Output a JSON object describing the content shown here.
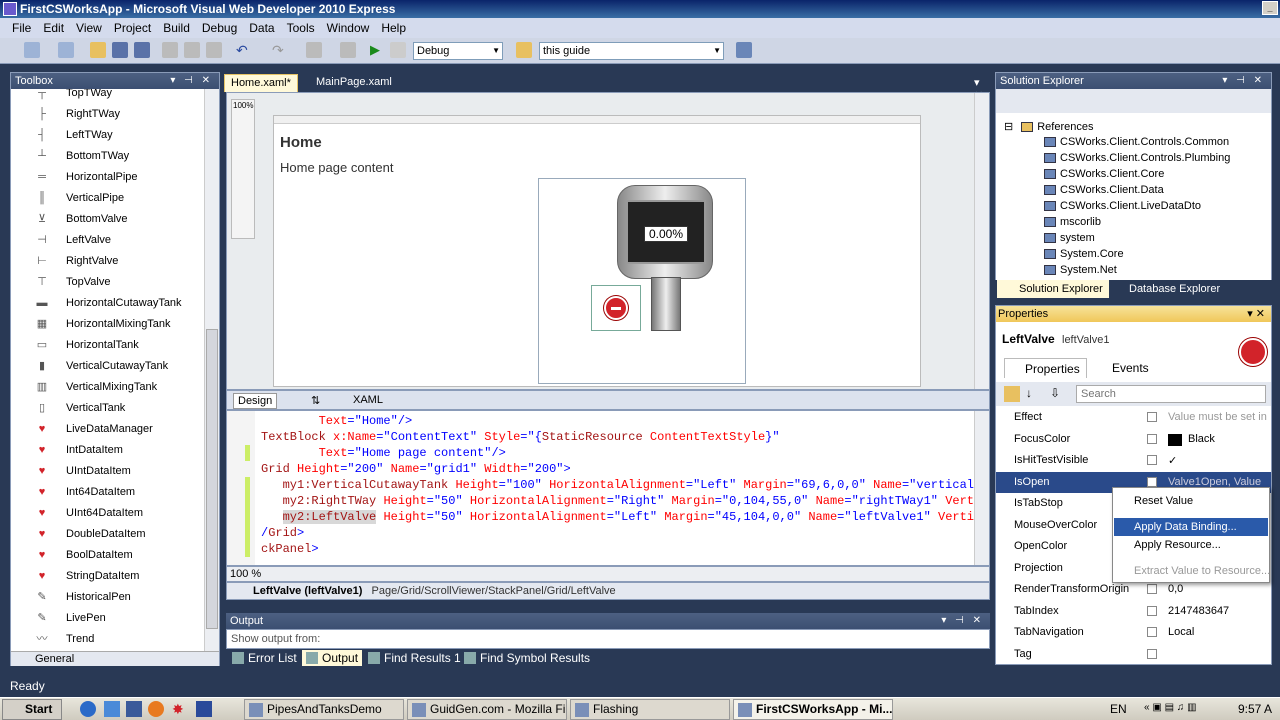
{
  "window": {
    "title": "FirstCSWorksApp - Microsoft Visual Web Developer 2010 Express"
  },
  "menu": [
    "File",
    "Edit",
    "View",
    "Project",
    "Build",
    "Debug",
    "Data",
    "Tools",
    "Window",
    "Help"
  ],
  "toolbar": {
    "config": "Debug",
    "find": "this guide"
  },
  "toolbox": {
    "title": "Toolbox",
    "items": [
      {
        "label": "TopTWay",
        "icon": "┬"
      },
      {
        "label": "RightTWay",
        "icon": "├"
      },
      {
        "label": "LeftTWay",
        "icon": "┤"
      },
      {
        "label": "BottomTWay",
        "icon": "┴"
      },
      {
        "label": "HorizontalPipe",
        "icon": "═"
      },
      {
        "label": "VerticalPipe",
        "icon": "║"
      },
      {
        "label": "BottomValve",
        "icon": "⊻"
      },
      {
        "label": "LeftValve",
        "icon": "⊣"
      },
      {
        "label": "RightValve",
        "icon": "⊢"
      },
      {
        "label": "TopValve",
        "icon": "⊤"
      },
      {
        "label": "HorizontalCutawayTank",
        "icon": "▬"
      },
      {
        "label": "HorizontalMixingTank",
        "icon": "▦"
      },
      {
        "label": "HorizontalTank",
        "icon": "▭"
      },
      {
        "label": "VerticalCutawayTank",
        "icon": "▮"
      },
      {
        "label": "VerticalMixingTank",
        "icon": "▥"
      },
      {
        "label": "VerticalTank",
        "icon": "▯"
      },
      {
        "label": "LiveDataManager",
        "icon": "♥"
      },
      {
        "label": "IntDataItem",
        "icon": "♥"
      },
      {
        "label": "UIntDataItem",
        "icon": "♥"
      },
      {
        "label": "Int64DataItem",
        "icon": "♥"
      },
      {
        "label": "UInt64DataItem",
        "icon": "♥"
      },
      {
        "label": "DoubleDataItem",
        "icon": "♥"
      },
      {
        "label": "BoolDataItem",
        "icon": "♥"
      },
      {
        "label": "StringDataItem",
        "icon": "♥"
      },
      {
        "label": "HistoricalPen",
        "icon": "✎"
      },
      {
        "label": "LivePen",
        "icon": "✎"
      },
      {
        "label": "Trend",
        "icon": "〰"
      }
    ],
    "general": "General"
  },
  "doc_tabs": [
    "Home.xaml*",
    "MainPage.xaml"
  ],
  "designer": {
    "zoom_small": "100%",
    "page_title": "Home",
    "page_content": "Home page content",
    "tank_value": "0.00%"
  },
  "split_tabs": {
    "design": "Design",
    "swap": "⇅",
    "xaml": "XAML"
  },
  "code": [
    {
      "indent": "        ",
      "parts": [
        [
          "at",
          "Text"
        ],
        [
          "pu",
          "=\"Home\"/>"
        ]
      ]
    },
    {
      "indent": "",
      "parts": [
        [
          "kw",
          "TextBlock "
        ],
        [
          "at",
          "x:Name"
        ],
        [
          "pu",
          "=\"ContentText\" "
        ],
        [
          "at",
          "Style"
        ],
        [
          "pu",
          "=\"{"
        ],
        [
          "kw",
          "StaticResource "
        ],
        [
          "at",
          "ContentTextStyle"
        ],
        [
          "pu",
          "}\""
        ]
      ]
    },
    {
      "indent": "        ",
      "parts": [
        [
          "at",
          "Text"
        ],
        [
          "pu",
          "=\"Home page content\"/>"
        ]
      ]
    },
    {
      "indent": "",
      "parts": [
        [
          "kw",
          "Grid "
        ],
        [
          "at",
          "Height"
        ],
        [
          "pu",
          "=\"200\" "
        ],
        [
          "at",
          "Name"
        ],
        [
          "pu",
          "=\"grid1\" "
        ],
        [
          "at",
          "Width"
        ],
        [
          "pu",
          "=\"200\">"
        ]
      ]
    },
    {
      "indent": "   ",
      "parts": [
        [
          "kw",
          "my1:VerticalCutawayTank "
        ],
        [
          "at",
          "Height"
        ],
        [
          "pu",
          "=\"100\" "
        ],
        [
          "at",
          "HorizontalAlignment"
        ],
        [
          "pu",
          "=\"Left\" "
        ],
        [
          "at",
          "Margin"
        ],
        [
          "pu",
          "=\"69,6,0,0\" "
        ],
        [
          "at",
          "Name"
        ],
        [
          "pu",
          "=\"verticalC"
        ]
      ]
    },
    {
      "indent": "   ",
      "parts": [
        [
          "kw",
          "my2:RightTWay "
        ],
        [
          "at",
          "Height"
        ],
        [
          "pu",
          "=\"50\" "
        ],
        [
          "at",
          "HorizontalAlignment"
        ],
        [
          "pu",
          "=\"Right\" "
        ],
        [
          "at",
          "Margin"
        ],
        [
          "pu",
          "=\"0,104,55,0\" "
        ],
        [
          "at",
          "Name"
        ],
        [
          "pu",
          "=\"rightTWay1\" "
        ],
        [
          "at",
          "Verti"
        ]
      ]
    },
    {
      "indent": "   ",
      "parts": [
        [
          "hl",
          "my2:LeftValve"
        ],
        [
          "kw",
          " "
        ],
        [
          "at",
          "Height"
        ],
        [
          "pu",
          "=\"50\" "
        ],
        [
          "at",
          "HorizontalAlignment"
        ],
        [
          "pu",
          "=\"Left\" "
        ],
        [
          "at",
          "Margin"
        ],
        [
          "pu",
          "=\"45,104,0,0\" "
        ],
        [
          "at",
          "Name"
        ],
        [
          "pu",
          "=\"leftValve1\" "
        ],
        [
          "at",
          "Vertic"
        ]
      ]
    },
    {
      "indent": "",
      "parts": [
        [
          "pu",
          "/"
        ],
        [
          "kw",
          "Grid"
        ],
        [
          "pu",
          ">"
        ]
      ]
    },
    {
      "indent": "",
      "parts": [
        [
          "kw",
          "ckPanel"
        ],
        [
          "pu",
          ">"
        ]
      ]
    }
  ],
  "code_zoom": "100 %",
  "breadcrumb": {
    "element": "LeftValve (leftValve1)",
    "path": "Page/Grid/ScrollViewer/StackPanel/Grid/LeftValve"
  },
  "output": {
    "title": "Output",
    "show_from": "Show output from:"
  },
  "output_tabs": [
    "Error List",
    "Output",
    "Find Results 1",
    "Find Symbol Results"
  ],
  "solution": {
    "title": "Solution Explorer",
    "references": "References",
    "items": [
      "CSWorks.Client.Controls.Common",
      "CSWorks.Client.Controls.Plumbing",
      "CSWorks.Client.Core",
      "CSWorks.Client.Data",
      "CSWorks.Client.LiveDataDto",
      "mscorlib",
      "system",
      "System.Core",
      "System.Net"
    ],
    "tabs": [
      "Solution Explorer",
      "Database Explorer"
    ]
  },
  "properties": {
    "title": "Properties",
    "object_type": "LeftValve",
    "object_name": "leftValve1",
    "tabs": [
      "Properties",
      "Events"
    ],
    "search_placeholder": "Search",
    "rows": [
      {
        "name": "Effect",
        "value": "Value must be set in"
      },
      {
        "name": "FocusColor",
        "value": "Black"
      },
      {
        "name": "IsHitTestVisible",
        "value": "✓"
      },
      {
        "name": "IsOpen",
        "value": "Valve1Open, Value"
      },
      {
        "name": "IsTabStop",
        "value": ""
      },
      {
        "name": "MouseOverColor",
        "value": ""
      },
      {
        "name": "OpenColor",
        "value": ""
      },
      {
        "name": "Projection",
        "value": ""
      },
      {
        "name": "RenderTransformOrigin",
        "value": "0,0"
      },
      {
        "name": "TabIndex",
        "value": "2147483647"
      },
      {
        "name": "TabNavigation",
        "value": "Local"
      },
      {
        "name": "Tag",
        "value": ""
      }
    ],
    "context_menu": [
      "Reset Value",
      "Apply Data Binding...",
      "Apply Resource...",
      "Extract Value to Resource..."
    ]
  },
  "status": "Ready",
  "taskbar": {
    "start": "Start",
    "tasks": [
      "PipesAndTanksDemo",
      "GuidGen.com - Mozilla Fir...",
      "Flashing",
      "FirstCSWorksApp - Mi..."
    ],
    "lang": "EN",
    "clock": "9:57 A"
  },
  "colors": {
    "accent": "#293955",
    "selection": "#2a4a8a",
    "tab_active": "#fff9d9"
  }
}
